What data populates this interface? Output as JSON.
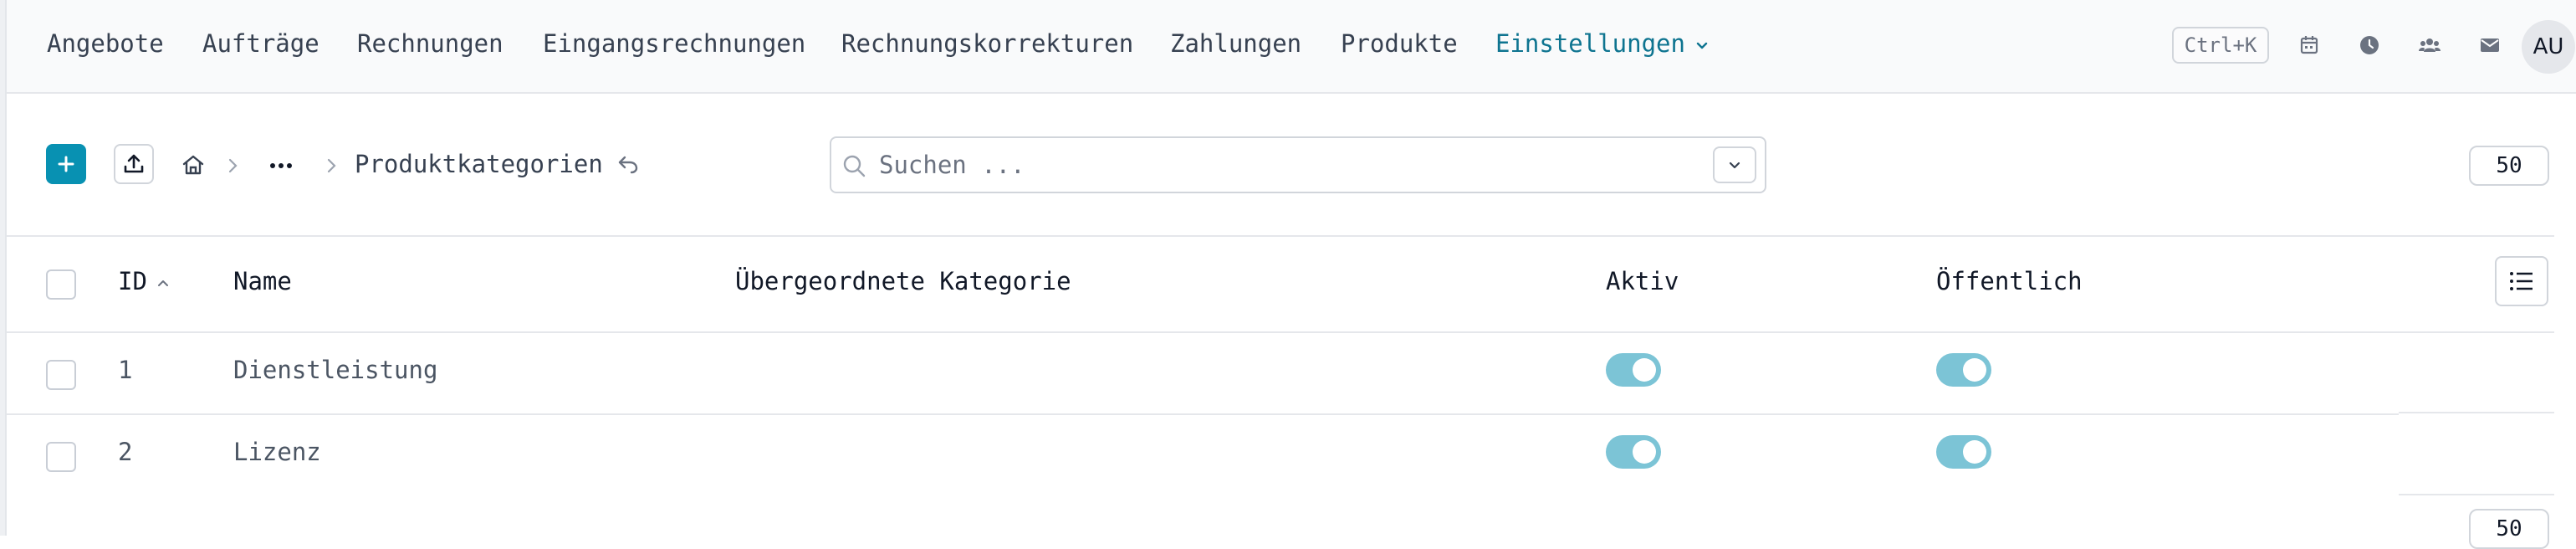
{
  "nav": {
    "items": [
      {
        "label": "Angebote"
      },
      {
        "label": "Aufträge"
      },
      {
        "label": "Rechnungen"
      },
      {
        "label": "Eingangsrechnungen"
      },
      {
        "label": "Rechnungskorrekturen"
      },
      {
        "label": "Zahlungen"
      },
      {
        "label": "Produkte"
      },
      {
        "label": "Einstellungen"
      }
    ],
    "active_item": "Einstellungen",
    "shortcut": "Ctrl+K",
    "icons": [
      "calendar-icon",
      "clock-icon",
      "users-icon",
      "mail-icon"
    ],
    "avatar": "AU",
    "accent_color": "#0e7490"
  },
  "toolbar": {
    "breadcrumb_current": "Produktkategorien",
    "search_placeholder": "Suchen ...",
    "page_size": "50",
    "add_button_color": "#0891b2"
  },
  "table": {
    "columns": [
      "ID",
      "Name",
      "Übergeordnete Kategorie",
      "Aktiv",
      "Öffentlich"
    ],
    "sort_column": "ID",
    "sort_direction": "ascending",
    "rows": [
      {
        "id": "1",
        "name": "Dienstleistung",
        "parent": "",
        "active": true,
        "public": true
      },
      {
        "id": "2",
        "name": "Lizenz",
        "parent": "",
        "active": true,
        "public": true
      }
    ]
  },
  "footer": {
    "page_size": "50"
  }
}
